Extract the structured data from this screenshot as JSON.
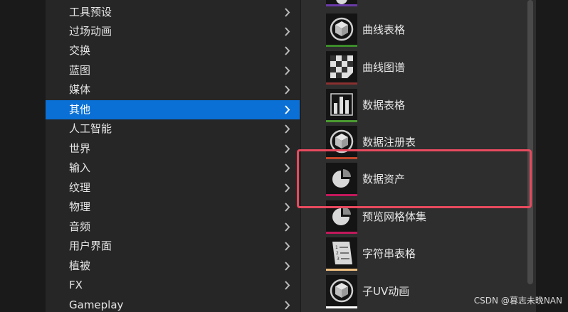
{
  "categories": [
    {
      "label": "工具预设"
    },
    {
      "label": "过场动画"
    },
    {
      "label": "交换"
    },
    {
      "label": "蓝图"
    },
    {
      "label": "媒体"
    },
    {
      "label": "其他",
      "selected": true
    },
    {
      "label": "人工智能"
    },
    {
      "label": "世界"
    },
    {
      "label": "输入"
    },
    {
      "label": "纹理"
    },
    {
      "label": "物理"
    },
    {
      "label": "音频"
    },
    {
      "label": "用户界面"
    },
    {
      "label": "植被"
    },
    {
      "label": "FX"
    },
    {
      "label": "Gameplay"
    }
  ],
  "assets": [
    {
      "label": "曲线表格",
      "icon": "cube-icon",
      "stripe": "#3c8c2a"
    },
    {
      "label": "曲线图谱",
      "icon": "checker-icon",
      "stripe": "#8a3030"
    },
    {
      "label": "数据表格",
      "icon": "bar-chart-icon",
      "stripe": "#4a9a30"
    },
    {
      "label": "数据注册表",
      "icon": "cube-icon",
      "stripe": "#c4462a"
    },
    {
      "label": "数据资产",
      "icon": "pie-icon",
      "stripe": "#c2185b"
    },
    {
      "label": "预览网格体集",
      "icon": "pie-icon",
      "stripe": "#c2185b"
    },
    {
      "label": "字符串表格",
      "icon": "document-list-icon",
      "stripe": "#f0c080"
    },
    {
      "label": "子UV动画",
      "icon": "cube-icon",
      "stripe": "#ffffff"
    }
  ],
  "colors": {
    "selected": "#0a70d6",
    "highlight": "#e84a5f"
  },
  "watermark": "CSDN @暮志未晚NAN"
}
